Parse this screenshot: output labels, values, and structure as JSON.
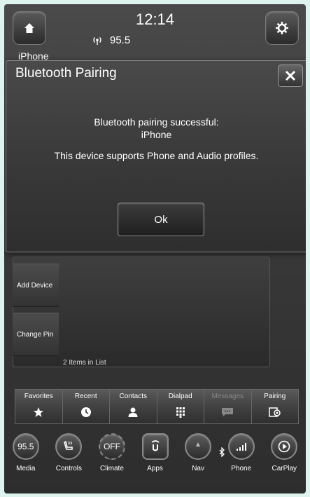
{
  "status_bar": {
    "time": "12:14",
    "radio_station": "95.5"
  },
  "background": {
    "device_peek": "iPhone",
    "side_buttons": [
      "Add Device",
      "Change Pin"
    ],
    "items_count": "2 Items in List"
  },
  "tabs": [
    {
      "label": "Favorites",
      "icon": "star-icon"
    },
    {
      "label": "Recent",
      "icon": "clock-icon"
    },
    {
      "label": "Contacts",
      "icon": "person-icon"
    },
    {
      "label": "Dialpad",
      "icon": "dialpad-icon"
    },
    {
      "label": "Messages",
      "icon": "message-icon"
    },
    {
      "label": "Pairing",
      "icon": "pairing-icon"
    }
  ],
  "nav": [
    {
      "label": "Media",
      "icon_text": "95.5"
    },
    {
      "label": "Controls",
      "icon_text": ""
    },
    {
      "label": "Climate",
      "icon_text": "OFF"
    },
    {
      "label": "Apps",
      "icon_text": ""
    },
    {
      "label": "Nav",
      "icon_text": ""
    },
    {
      "label": "Phone",
      "icon_text": ""
    },
    {
      "label": "CarPlay",
      "icon_text": ""
    }
  ],
  "dialog": {
    "title": "Bluetooth Pairing",
    "message_line1": "Bluetooth pairing successful:",
    "message_line2": "iPhone",
    "message_line3": "This device supports Phone and Audio profiles.",
    "ok_label": "Ok"
  }
}
